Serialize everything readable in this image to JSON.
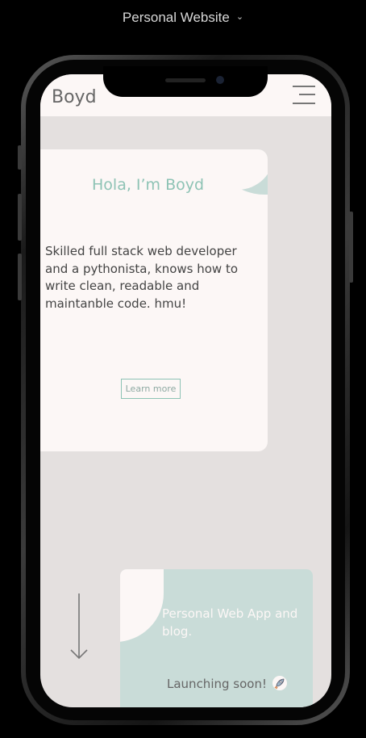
{
  "app": {
    "title": "Personal Website"
  },
  "site": {
    "brand": "Boyd",
    "hero": {
      "greeting": "Hola, I’m Boyd",
      "bio": "Skilled full stack web developer and a pythonista, knows how to write clean, readable and maintanble code. hmu!",
      "cta_label": "Learn more"
    },
    "project": {
      "title": "Personal Web App and blog.",
      "status": "Launching soon!"
    }
  },
  "icons": {
    "dropdown": "chevron-down-icon",
    "menu": "hamburger-menu-icon",
    "scroll": "arrow-down-icon",
    "status": "rocket-icon"
  },
  "colors": {
    "accent": "#8ec3b5",
    "card_bg": "#fcf7f6",
    "page_bg": "#e4e0df",
    "mint": "#c9dcd8"
  }
}
